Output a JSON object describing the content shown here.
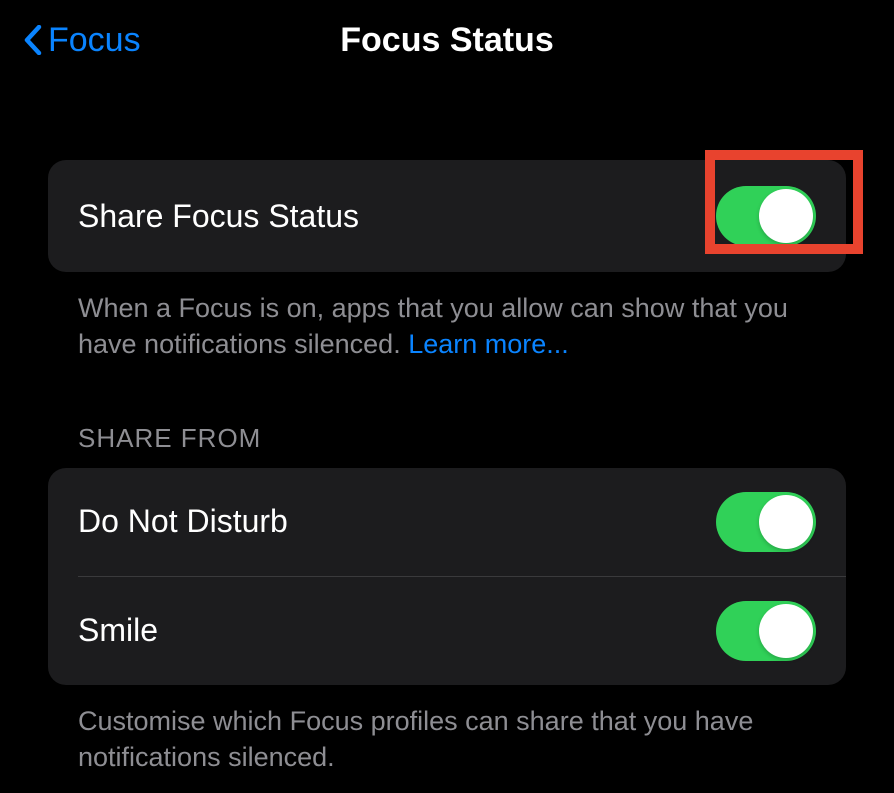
{
  "nav": {
    "back_label": "Focus",
    "title": "Focus Status"
  },
  "share_section": {
    "label": "Share Focus Status",
    "enabled": true,
    "footer_text": "When a Focus is on, apps that you allow can show that you have notifications silenced. ",
    "learn_more": "Learn more..."
  },
  "share_from": {
    "header": "SHARE FROM",
    "items": [
      {
        "label": "Do Not Disturb",
        "enabled": true
      },
      {
        "label": "Smile",
        "enabled": true
      }
    ],
    "footer_text": "Customise which Focus profiles can share that you have notifications silenced."
  },
  "colors": {
    "accent": "#0a84ff",
    "toggle_on": "#30d158",
    "highlight": "#e8432e"
  }
}
